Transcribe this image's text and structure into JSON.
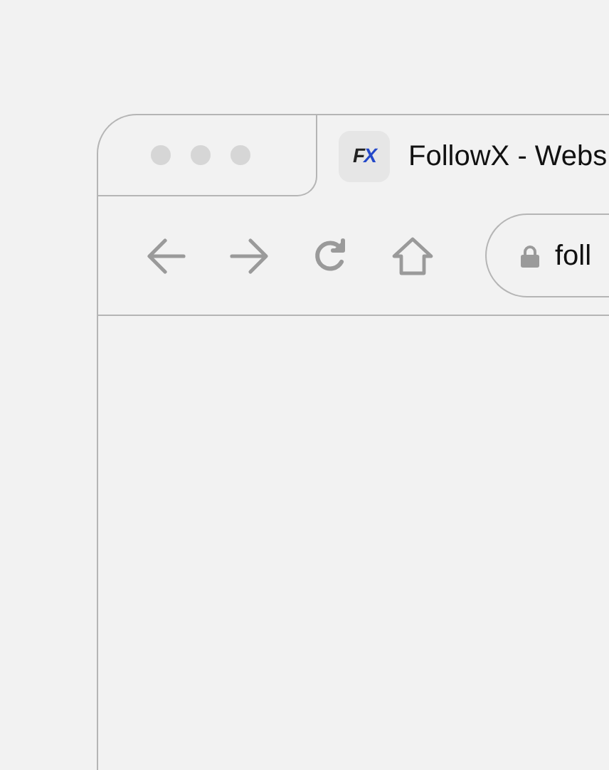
{
  "tab": {
    "logo": "FX",
    "title": "FollowX - Webs"
  },
  "address_bar": {
    "url": "foll"
  }
}
